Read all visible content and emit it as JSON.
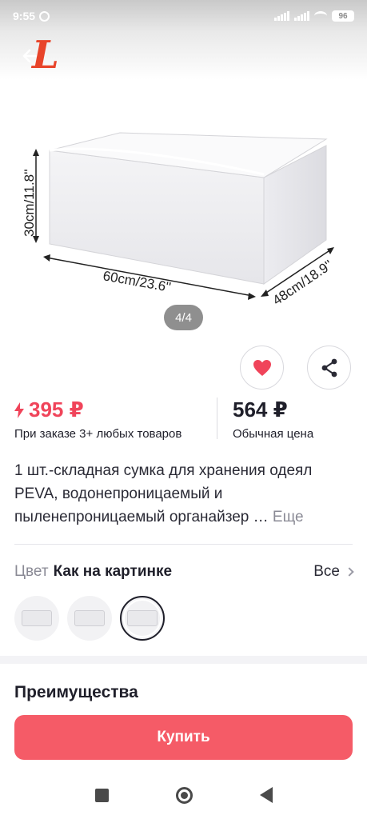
{
  "status_bar": {
    "time": "9:55",
    "battery": "96"
  },
  "gallery": {
    "counter": "4/4",
    "dimensions": {
      "height_label": "30cm/11.8''",
      "width_label": "60cm/23.6''",
      "depth_label": "48cm/18.9''"
    }
  },
  "price": {
    "promo": "395 ₽",
    "promo_caption": "При заказе 3+ любых товаров",
    "regular": "564 ₽",
    "regular_caption": "Обычная цена"
  },
  "description": {
    "text": "1 шт.-складная сумка для хранения одеял PEVA, водонепроницаемый и пыленепроницаемый органайзер …",
    "more": "Еще"
  },
  "color": {
    "label": "Цвет",
    "value": "Как на картинке",
    "all": "Все",
    "selected_index": 2
  },
  "section": {
    "title": "Преимущества"
  },
  "cta": {
    "buy": "Купить"
  },
  "colors": {
    "accent": "#f55b67",
    "price_red": "#f0445a",
    "brand": "#e8442a"
  },
  "icons": [
    "back-arrow-icon",
    "heart-icon",
    "share-icon",
    "bolt-icon",
    "chevron-right-icon"
  ]
}
